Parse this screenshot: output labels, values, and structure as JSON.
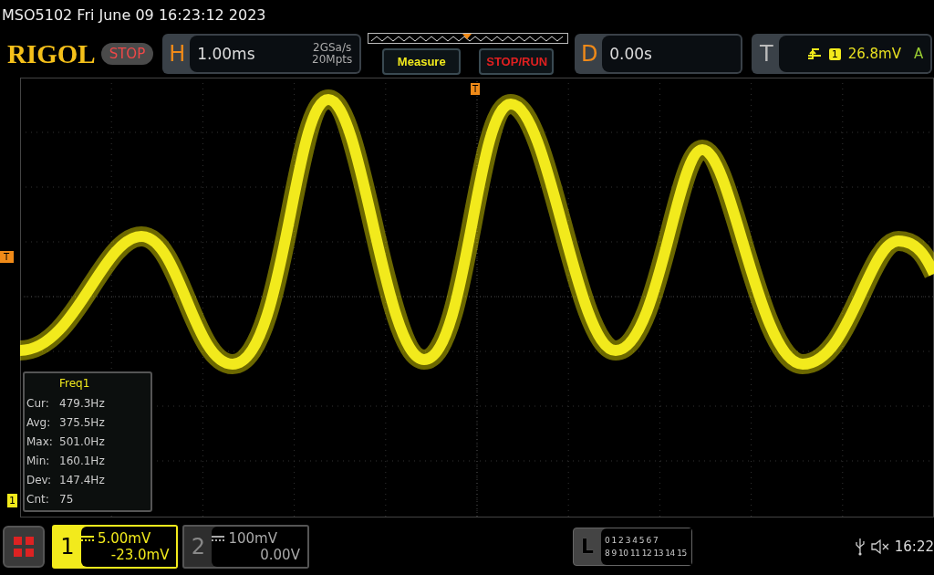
{
  "title_line": "MSO5102  Fri June 09 16:23:12 2023",
  "logo": "RIGOL",
  "run_state": "STOP",
  "horizontal": {
    "label": "H",
    "timebase": "1.00ms",
    "sample_rate": "2GSa/s",
    "memory_depth": "20Mpts"
  },
  "buttons": [
    {
      "label": "Measure",
      "kind": "measure"
    },
    {
      "label": "STOP/RUN",
      "kind": "stoprun"
    }
  ],
  "delay": {
    "label": "D",
    "value": "0.00s"
  },
  "trigger": {
    "label": "T",
    "source": "1",
    "level": "26.8mV",
    "mode": "A"
  },
  "markers": {
    "trigger_position": "T",
    "trigger_level": "T",
    "channel_1": "1"
  },
  "measurement": {
    "title": "Freq1",
    "rows": [
      {
        "label": "Cur:",
        "value": "479.3Hz"
      },
      {
        "label": "Avg:",
        "value": "375.5Hz"
      },
      {
        "label": "Max:",
        "value": "501.0Hz"
      },
      {
        "label": "Min:",
        "value": "160.1Hz"
      },
      {
        "label": "Dev:",
        "value": "147.4Hz"
      },
      {
        "label": "Cnt:",
        "value": "75"
      }
    ]
  },
  "channels": [
    {
      "number": "1",
      "scale": "5.00mV",
      "offset": "-23.0mV",
      "selected": true
    },
    {
      "number": "2",
      "scale": "100mV",
      "offset": "0.00V",
      "selected": false
    }
  ],
  "logic": {
    "label": "L",
    "rows": [
      "0 1 2 3 4 5 6 7",
      "8 9 10 11 12 13 14 15"
    ]
  },
  "clock": "16:22"
}
